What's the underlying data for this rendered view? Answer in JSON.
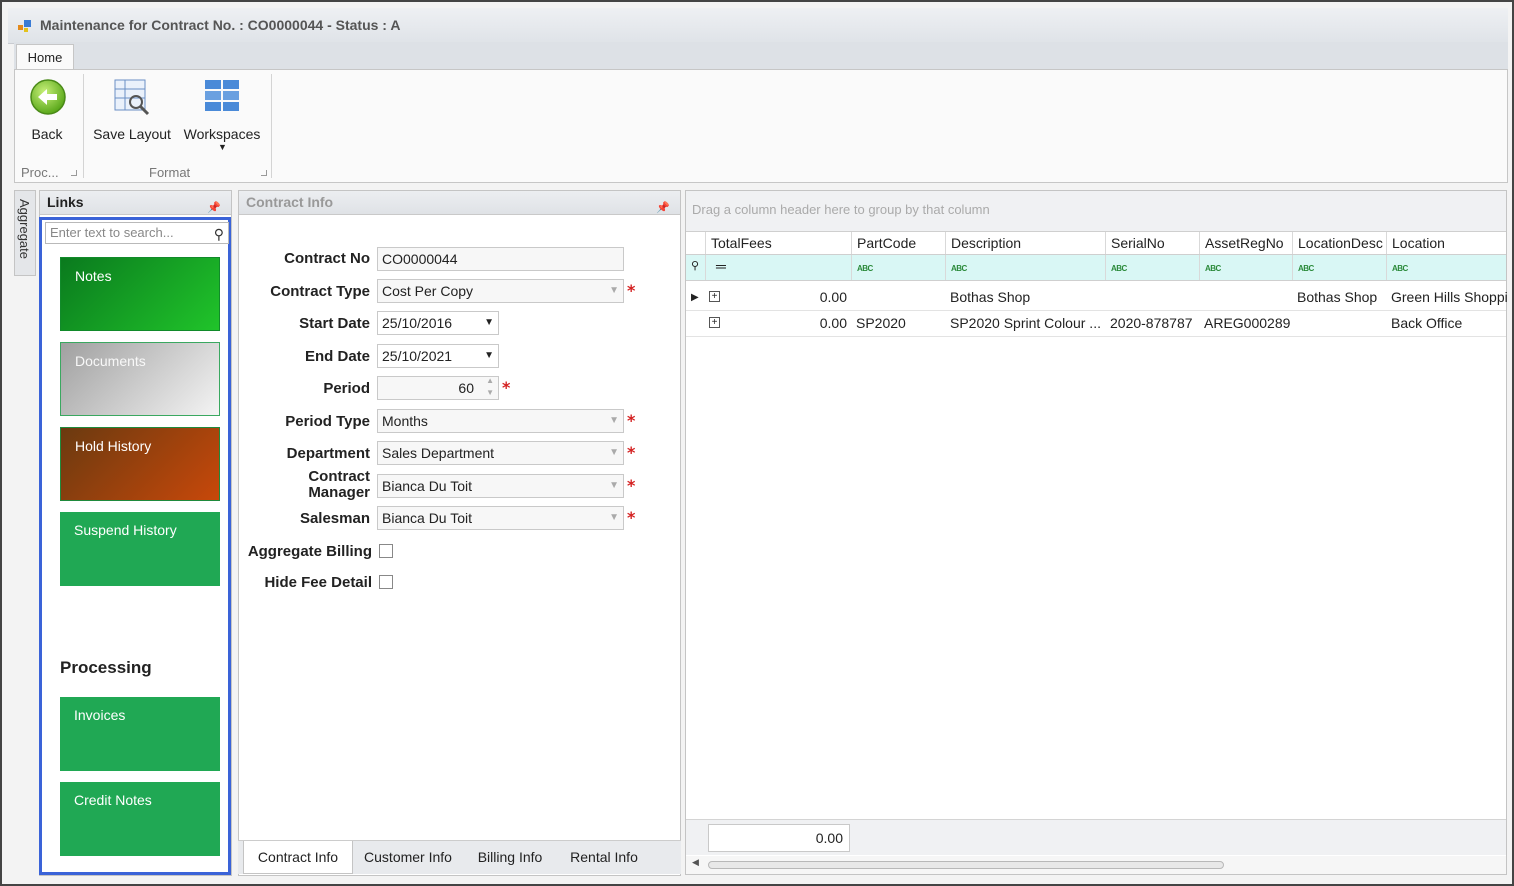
{
  "window": {
    "title": "Maintenance for Contract No. : CO0000044 - Status : A"
  },
  "ribbon": {
    "tab": "Home",
    "back_label": "Back",
    "save_layout_label": "Save Layout",
    "workspaces_label": "Workspaces",
    "group_proc_label": "Proc...",
    "group_format_label": "Format"
  },
  "aggregate_tab": "Aggregate",
  "links": {
    "title": "Links",
    "search_placeholder": "Enter text to search...",
    "tiles": [
      {
        "label": "Notes",
        "color": "#1aa33a"
      },
      {
        "label": "Documents",
        "color": "#b8b8b8"
      },
      {
        "label": "Hold History",
        "color": "#b14a1c"
      },
      {
        "label": "Suspend History",
        "color": "#20a854"
      }
    ],
    "processing_header": "Processing",
    "processing_tiles": [
      {
        "label": "Invoices",
        "color": "#20a854"
      },
      {
        "label": "Credit Notes",
        "color": "#20a854"
      }
    ]
  },
  "contract_info": {
    "title": "Contract Info",
    "fields": {
      "contract_no_label": "Contract No",
      "contract_no": "CO0000044",
      "contract_type_label": "Contract Type",
      "contract_type": "Cost Per Copy",
      "start_date_label": "Start Date",
      "start_date": "25/10/2016",
      "end_date_label": "End Date",
      "end_date": "25/10/2021",
      "period_label": "Period",
      "period": "60",
      "period_type_label": "Period Type",
      "period_type": "Months",
      "department_label": "Department",
      "department": "Sales Department",
      "contract_manager_label_1": "Contract",
      "contract_manager_label_2": "Manager",
      "contract_manager": "Bianca Du Toit",
      "salesman_label": "Salesman",
      "salesman": "Bianca Du Toit",
      "aggregate_billing_label": "Aggregate Billing",
      "hide_fee_detail_label": "Hide Fee Detail"
    },
    "tabs": [
      "Contract Info",
      "Customer Info",
      "Billing Info",
      "Rental Info"
    ]
  },
  "grid": {
    "group_hint": "Drag a column header here to group by that column",
    "columns": [
      "TotalFees",
      "PartCode",
      "Description",
      "SerialNo",
      "AssetRegNo",
      "LocationDesc",
      "Location"
    ],
    "rows": [
      [
        "0.00",
        "",
        "Bothas Shop",
        "",
        "",
        "Bothas Shop",
        "Green Hills Shoppin"
      ],
      [
        "0.00",
        "SP2020",
        "SP2020 Sprint Colour ...",
        "2020-878787",
        "AREG000289",
        "",
        "Back Office"
      ]
    ],
    "total": "0.00"
  }
}
